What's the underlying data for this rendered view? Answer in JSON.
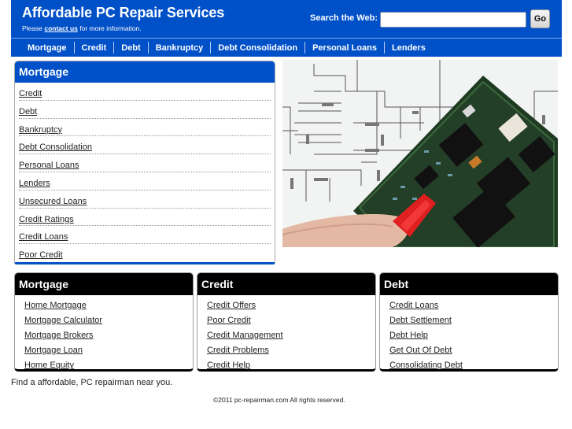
{
  "header": {
    "title": "Affordable PC Repair Services",
    "tagline_prefix": "Please ",
    "tagline_link": "contact us",
    "tagline_suffix": " for more information.",
    "search_label": "Search the Web:",
    "search_value": "",
    "search_placeholder": "",
    "go_label": "Go"
  },
  "nav": [
    "Mortgage",
    "Credit",
    "Debt",
    "Bankruptcy",
    "Debt Consolidation",
    "Personal Loans",
    "Lenders"
  ],
  "sidebar": {
    "title": "Mortgage",
    "items": [
      "Credit",
      "Debt",
      "Bankruptcy",
      "Debt Consolidation",
      "Personal Loans",
      "Lenders",
      "Unsecured Loans",
      "Credit Ratings",
      "Credit Loans",
      "Poor Credit"
    ]
  },
  "hero": {
    "alt": "Circuit board over schematic diagram with red probe"
  },
  "boxes": [
    {
      "title": "Mortgage",
      "items": [
        "Home Mortgage",
        "Mortgage Calculator",
        "Mortgage Brokers",
        "Mortgage Loan",
        "Home Equity"
      ]
    },
    {
      "title": "Credit",
      "items": [
        "Credit Offers",
        "Poor Credit",
        "Credit Management",
        "Credit Problems",
        "Credit Help"
      ]
    },
    {
      "title": "Debt",
      "items": [
        "Credit Loans",
        "Debt Settlement",
        "Debt Help",
        "Get Out Of Debt",
        "Consolidating Debt"
      ]
    }
  ],
  "footer": {
    "tagline": "Find a affordable, PC repairman near you.",
    "copyright": "©2011 pc-repairman.com All rights reserved."
  },
  "colors": {
    "brand_blue": "#0050c8",
    "box_head_black": "#000000"
  }
}
